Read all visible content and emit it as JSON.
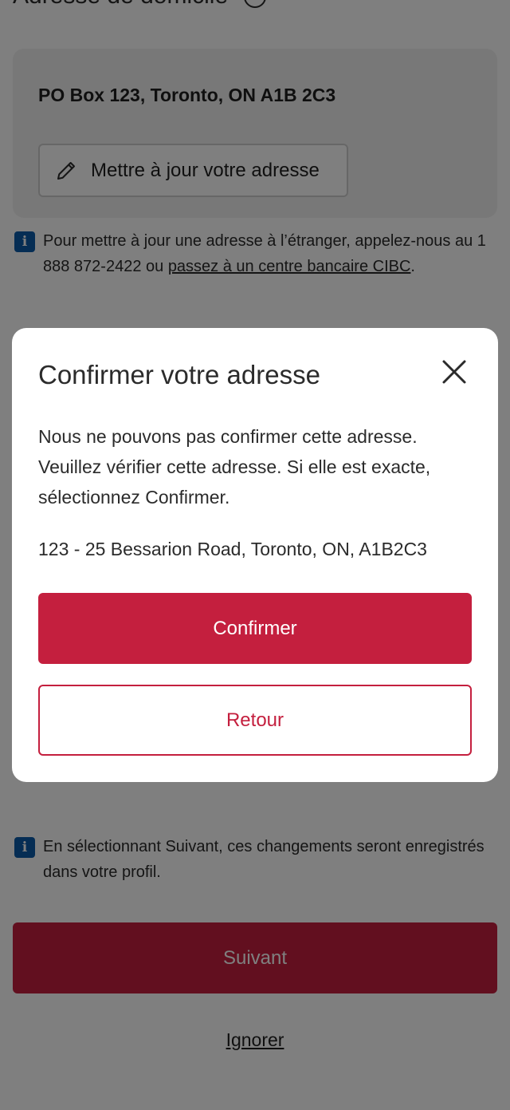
{
  "page": {
    "section_title": "Adresse de domicile",
    "current_address": "PO Box 123, Toronto, ON A1B 2C3",
    "update_button_label": "Mettre à jour votre adresse",
    "foreign_info": {
      "text_before": "Pour mettre à jour une adresse à l’étranger, appelez-nous au 1 888 872-2422 ou ",
      "link_text": "passez à un centre bancaire CIBC",
      "text_after": "."
    },
    "save_info": "En sélectionnant Suivant, ces changements seront enregistrés dans votre profil.",
    "next_button_label": "Suivant",
    "skip_link_label": "Ignorer"
  },
  "modal": {
    "title": "Confirmer votre adresse",
    "message": "Nous ne pouvons pas confirmer cette adresse. Veuillez vérifier cette adresse. Si elle est exacte, sélectionnez Confirmer.",
    "suggested_address": "123 - 25 Bessarion Road, Toronto, ON, A1B2C3",
    "confirm_label": "Confirmer",
    "back_label": "Retour"
  },
  "icons": {
    "help": "help-circle-icon",
    "pencil": "pencil-icon",
    "info": "info-icon",
    "close": "close-icon"
  },
  "colors": {
    "brand_red": "#c41f3e",
    "info_blue": "#0b5aa8",
    "overlay": "rgba(0,0,0,0.5)"
  }
}
